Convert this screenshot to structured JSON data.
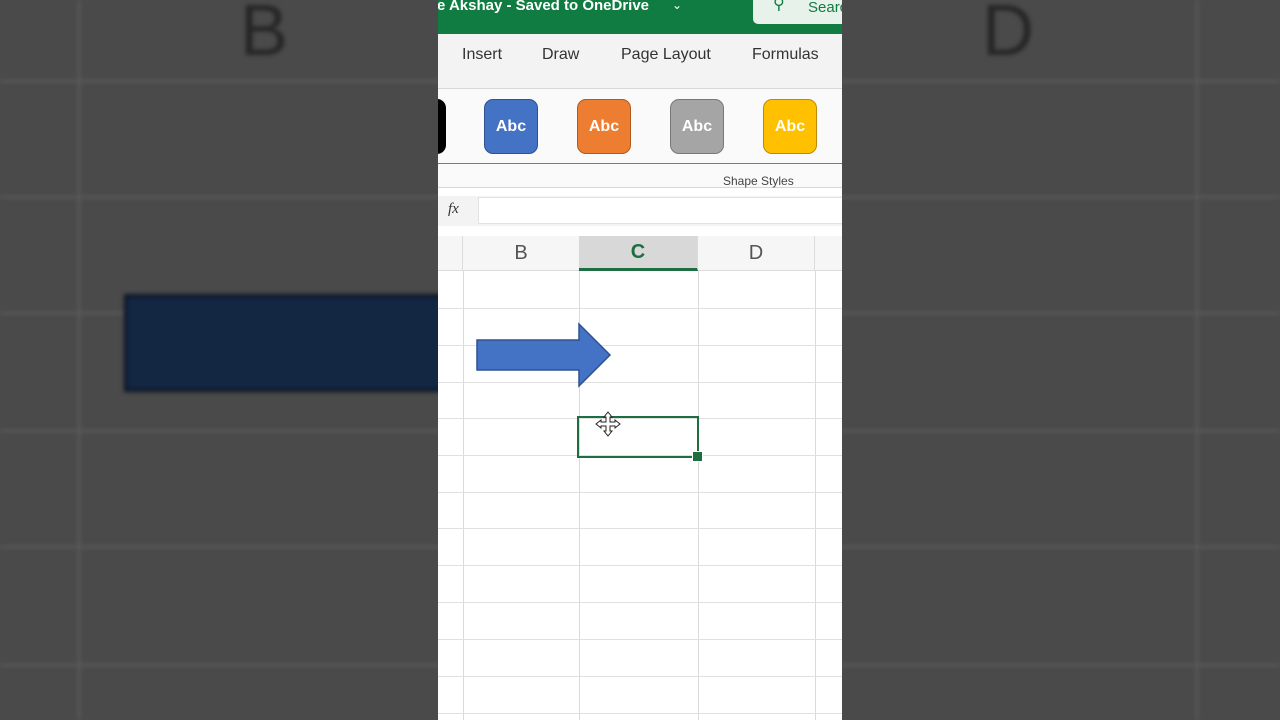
{
  "titlebar": {
    "title": "e Akshay  -  Saved to OneDrive",
    "search_label": "Search"
  },
  "tabs": [
    "Insert",
    "Draw",
    "Page Layout",
    "Formulas"
  ],
  "shape_styles": {
    "buttons": [
      {
        "label": "Abc",
        "fill": "#4472c4",
        "border": "#2f528f"
      },
      {
        "label": "Abc",
        "fill": "#ed7d31",
        "border": "#ae5a21"
      },
      {
        "label": "Abc",
        "fill": "#a5a5a5",
        "border": "#787878"
      },
      {
        "label": "Abc",
        "fill": "#ffc000",
        "border": "#bc8c00"
      }
    ],
    "group_label": "Shape Styles"
  },
  "formula_bar": {
    "fx_label": "fx",
    "value": ""
  },
  "columns": [
    "B",
    "C",
    "D"
  ],
  "selected_column": "C",
  "background": {
    "column_letters": [
      "B",
      "D"
    ]
  },
  "colors": {
    "excel_green": "#107c41",
    "selection": "#1e6e42",
    "arrow_fill": "#4472c4"
  }
}
